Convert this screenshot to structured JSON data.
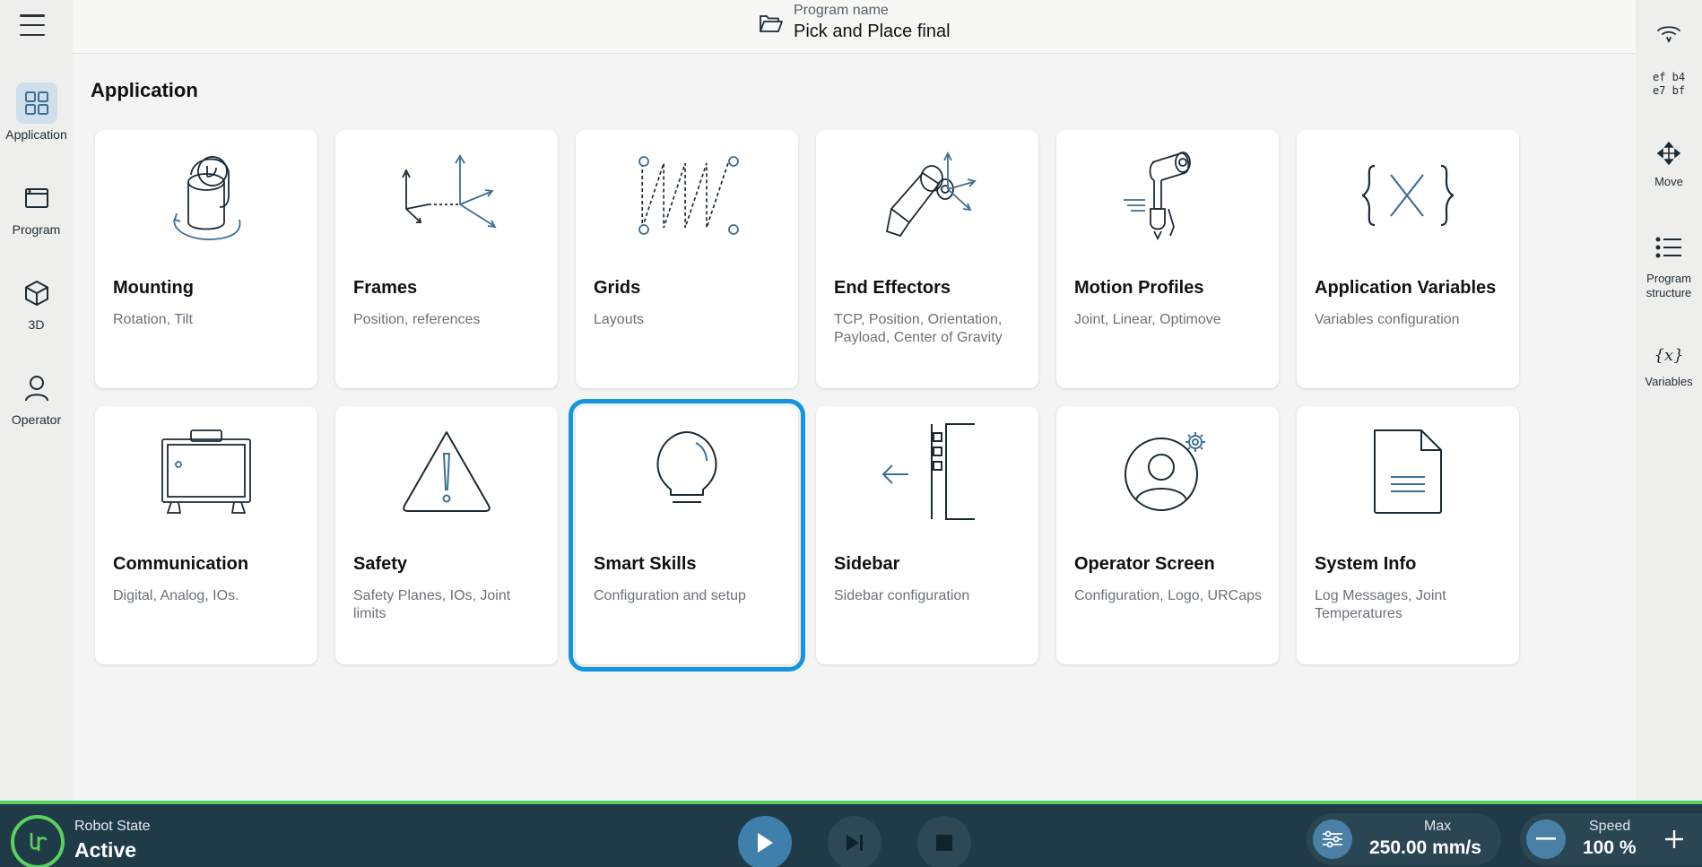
{
  "leftnav": {
    "menu_icon": "hamburger-icon",
    "items": [
      {
        "label": "Application",
        "icon": "grid-icon",
        "active": true
      },
      {
        "label": "Program",
        "icon": "window-icon"
      },
      {
        "label": "3D",
        "icon": "cube-icon"
      },
      {
        "label": "Operator",
        "icon": "person-icon"
      }
    ]
  },
  "topbar": {
    "caption": "Program name",
    "program_name": "Pick and Place final",
    "icon": "folder-open-icon"
  },
  "rightrail": {
    "device_id_line1": "ef b4",
    "device_id_line2": "e7 bf",
    "items": [
      {
        "label": "Move",
        "icon": "move-arrows-icon"
      },
      {
        "label": "Program",
        "label2": "structure",
        "icon": "list-icon"
      },
      {
        "label": "Variables",
        "icon": "variables-icon"
      }
    ]
  },
  "main": {
    "section_title": "Application",
    "cards": [
      {
        "title": "Mounting",
        "subtitle": "Rotation, Tilt",
        "icon": "mounting-icon"
      },
      {
        "title": "Frames",
        "subtitle": "Position, references",
        "icon": "frames-icon"
      },
      {
        "title": "Grids",
        "subtitle": "Layouts",
        "icon": "grids-icon"
      },
      {
        "title": "End Effectors",
        "subtitle": "TCP, Position, Orientation, Payload, Center of Gravity",
        "icon": "end-effector-icon"
      },
      {
        "title": "Motion Profiles",
        "subtitle": "Joint, Linear, Optimove",
        "icon": "motion-profiles-icon"
      },
      {
        "title": "Application Variables",
        "subtitle": "Variables configuration",
        "icon": "application-variables-icon"
      },
      {
        "title": "Communication",
        "subtitle": "Digital, Analog, IOs.",
        "icon": "communication-icon"
      },
      {
        "title": "Safety",
        "subtitle": "Safety Planes, IOs, Joint limits",
        "icon": "safety-warning-icon"
      },
      {
        "title": "Smart Skills",
        "subtitle": "Configuration and setup",
        "icon": "lightbulb-icon",
        "selected": true
      },
      {
        "title": "Sidebar",
        "subtitle": "Sidebar configuration",
        "icon": "sidebar-icon"
      },
      {
        "title": "Operator Screen",
        "subtitle": "Configuration, Logo, URCaps",
        "icon": "operator-screen-icon"
      },
      {
        "title": "System Info",
        "subtitle": "Log Messages, Joint Temperatures",
        "icon": "document-icon"
      }
    ]
  },
  "bottombar": {
    "robot_state_caption": "Robot State",
    "robot_state_value": "Active",
    "max_caption": "Max",
    "max_value": "250.00 mm/s",
    "speed_caption": "Speed",
    "speed_value": "100 %",
    "accent_color": "#5ad05e",
    "bar_color": "#1f3b48"
  }
}
